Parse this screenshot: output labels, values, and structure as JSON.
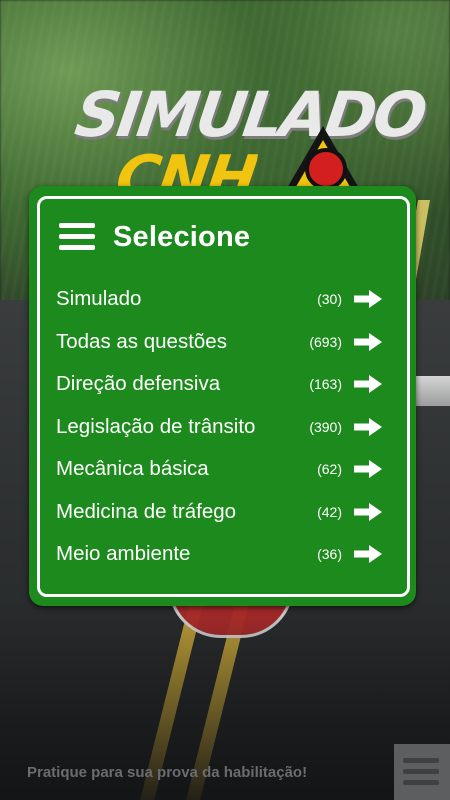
{
  "logo": {
    "title": "SIMULADO",
    "subtitle": "CNH"
  },
  "menu": {
    "title": "Selecione",
    "items": [
      {
        "label": "Simulado",
        "count": "(30)"
      },
      {
        "label": "Todas as questões",
        "count": "(693)"
      },
      {
        "label": "Direção defensiva",
        "count": "(163)"
      },
      {
        "label": "Legislação de trânsito",
        "count": "(390)"
      },
      {
        "label": "Mecânica básica",
        "count": "(62)"
      },
      {
        "label": "Medicina de tráfego",
        "count": "(42)"
      },
      {
        "label": "Meio ambiente",
        "count": "(36)"
      }
    ],
    "item_icon": "arrow-right-icon",
    "header_icon": "hamburger-menu-icon"
  },
  "footer": {
    "tagline": "Pratique para sua prova da habilitação!",
    "menu_icon": "hamburger-menu-icon"
  },
  "colors": {
    "panel_green": "#1d8a1d",
    "panel_border": "#ffffff",
    "logo_yellow": "#f1c40f"
  }
}
